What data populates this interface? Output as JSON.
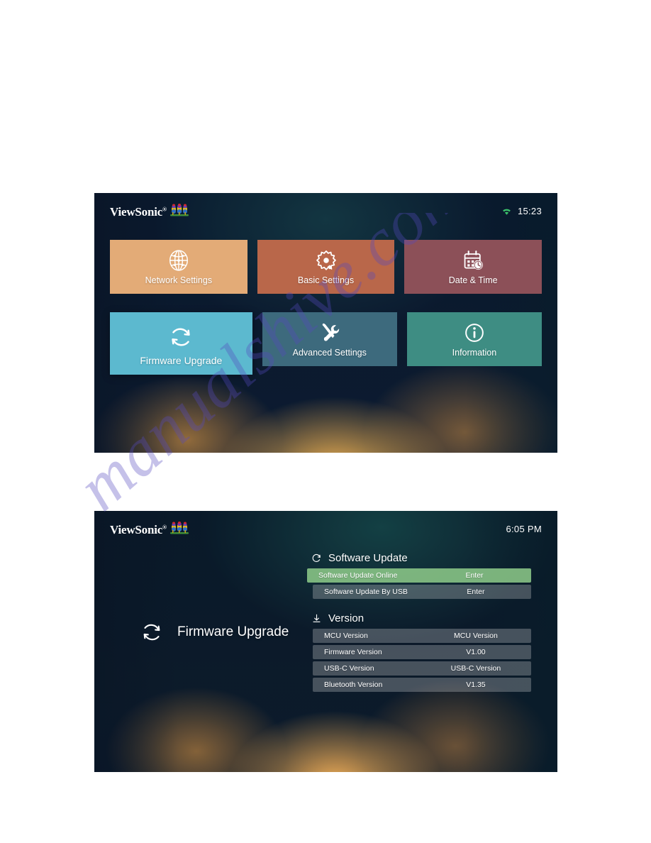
{
  "brand": {
    "logo_text": "ViewSonic",
    "logo_trademark": "®",
    "logo_icon": "viewsonic-finches-logo"
  },
  "watermark": {
    "text": "manualshive.com",
    "color": "#5648be"
  },
  "home_screen": {
    "statusbar": {
      "wifi_icon": "wifi-icon",
      "wifi_color": "#3ac06a",
      "clock": "15:23"
    },
    "tiles": [
      {
        "label": "Network Settings",
        "icon": "globe-network-icon",
        "color": "#e3ab77",
        "focused": false
      },
      {
        "label": "Basic Settings",
        "icon": "gear-wrench-icon",
        "color": "#b9674a",
        "focused": false
      },
      {
        "label": "Date & Time",
        "icon": "calendar-clock-icon",
        "color": "#8c5058",
        "focused": false
      },
      {
        "label": "Firmware Upgrade",
        "icon": "refresh-circular-arrows-icon",
        "color": "#5cb9cf",
        "focused": true
      },
      {
        "label": "Advanced Settings",
        "icon": "screwdriver-wrench-icon",
        "color": "#3d6a7d",
        "focused": false
      },
      {
        "label": "Information",
        "icon": "info-circle-icon",
        "color": "#3e8d83",
        "focused": false
      }
    ]
  },
  "firmware_screen": {
    "statusbar": {
      "clock": "6:05 PM"
    },
    "page_title": "Firmware Upgrade",
    "page_title_icon": "refresh-circular-arrows-icon",
    "sections": [
      {
        "heading": "Software Update",
        "heading_icon": "refresh-icon",
        "rows": [
          {
            "label": "Software Update Online",
            "value": "Enter",
            "highlighted": true
          },
          {
            "label": "Software Update By USB",
            "value": "Enter",
            "highlighted": false
          }
        ]
      },
      {
        "heading": "Version",
        "heading_icon": "download-arrow-icon",
        "rows": [
          {
            "label": "MCU Version",
            "value": "MCU Version",
            "highlighted": false
          },
          {
            "label": "Firmware Version",
            "value": "V1.00",
            "highlighted": false
          },
          {
            "label": "USB-C Version",
            "value": "USB-C Version",
            "highlighted": false
          },
          {
            "label": "Bluetooth Version",
            "value": "V1.35",
            "highlighted": false
          }
        ]
      }
    ],
    "highlight_color": "#8bc788"
  }
}
